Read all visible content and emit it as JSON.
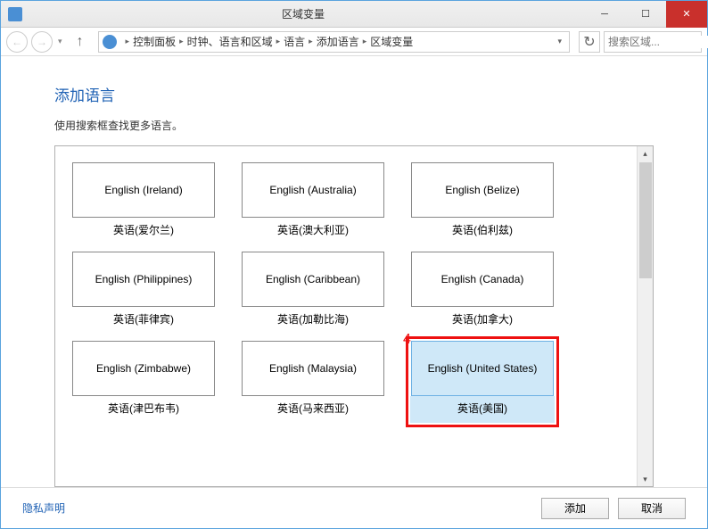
{
  "window": {
    "title": "区域变量"
  },
  "breadcrumb": {
    "items": [
      "控制面板",
      "时钟、语言和区域",
      "语言",
      "添加语言",
      "区域变量"
    ],
    "search_placeholder": "搜索区域..."
  },
  "page": {
    "title": "添加语言",
    "subtitle": "使用搜索框查找更多语言。"
  },
  "annotation": "4",
  "languages": [
    {
      "en": "English (Ireland)",
      "local": "英语(爱尔兰)",
      "selected": false
    },
    {
      "en": "English (Australia)",
      "local": "英语(澳大利亚)",
      "selected": false
    },
    {
      "en": "English (Belize)",
      "local": "英语(伯利兹)",
      "selected": false
    },
    {
      "en": "English (Philippines)",
      "local": "英语(菲律宾)",
      "selected": false
    },
    {
      "en": "English (Caribbean)",
      "local": "英语(加勒比海)",
      "selected": false
    },
    {
      "en": "English (Canada)",
      "local": "英语(加拿大)",
      "selected": false
    },
    {
      "en": "English (Zimbabwe)",
      "local": "英语(津巴布韦)",
      "selected": false
    },
    {
      "en": "English (Malaysia)",
      "local": "英语(马来西亚)",
      "selected": false
    },
    {
      "en": "English (United States)",
      "local": "英语(美国)",
      "selected": true
    }
  ],
  "footer": {
    "privacy": "隐私声明",
    "add": "添加",
    "cancel": "取消"
  }
}
